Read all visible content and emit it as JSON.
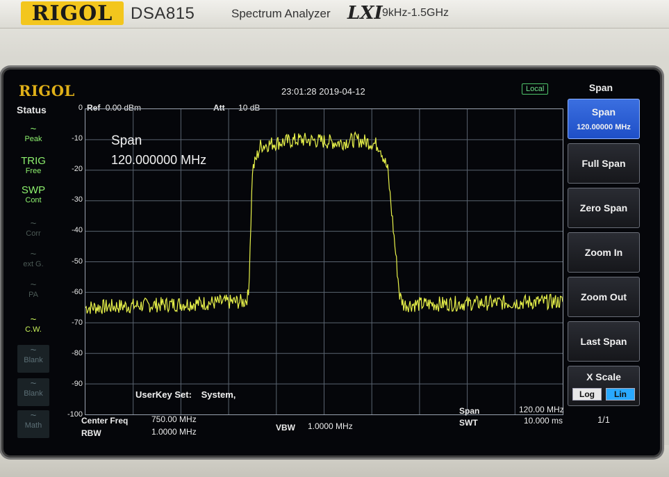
{
  "device": {
    "brand": "RIGOL",
    "model": "DSA815",
    "product": "Spectrum Analyzer",
    "lxi": "LXI",
    "range": "9kHz-1.5GHz"
  },
  "screen": {
    "logo": "RIGOL",
    "timestamp": "23:01:28 2019-04-12",
    "remote": "Local"
  },
  "status": {
    "title": "Status",
    "items": [
      {
        "symbol": "~",
        "label": "Peak",
        "state": "on"
      },
      {
        "symbol": "TRIG",
        "label": "Free",
        "state": "on"
      },
      {
        "symbol": "SWP",
        "label": "Cont",
        "state": "on"
      },
      {
        "symbol": "~",
        "label": "Corr",
        "state": "off"
      },
      {
        "symbol": "~",
        "label": "ext G.",
        "state": "off"
      },
      {
        "symbol": "~",
        "label": "PA",
        "state": "off"
      },
      {
        "symbol": "~",
        "label": "C.W.",
        "state": "lit"
      },
      {
        "symbol": "~",
        "label": "Blank",
        "state": "tile"
      },
      {
        "symbol": "~",
        "label": "Blank",
        "state": "tile"
      },
      {
        "symbol": "~",
        "label": "Math",
        "state": "tile"
      }
    ]
  },
  "header": {
    "ref_label": "Ref",
    "ref_value": "0.00 dBm",
    "att_label": "Att",
    "att_value": "10 dB"
  },
  "overlay": {
    "param": "Span",
    "value": "120.000000 MHz",
    "userkey_label": "UserKey Set:",
    "userkey_value": "System,"
  },
  "footer": {
    "center_label": "Center Freq",
    "center_value": "750.00 MHz",
    "rbw_label": "RBW",
    "rbw_value": "1.0000 MHz",
    "vbw_label": "VBW",
    "vbw_value": "1.0000 MHz",
    "span_label": "Span",
    "span_value": "120.00 MHz",
    "swt_label": "SWT",
    "swt_value": "10.000 ms"
  },
  "menu": {
    "title": "Span",
    "items": [
      {
        "label": "Span",
        "sub": "120.00000 MHz",
        "active": true
      },
      {
        "label": "Full Span"
      },
      {
        "label": "Zero Span"
      },
      {
        "label": "Zoom In"
      },
      {
        "label": "Zoom Out"
      },
      {
        "label": "Last Span"
      },
      {
        "label": "X Scale",
        "options": [
          "Log",
          "Lin"
        ],
        "selected": "Lin"
      }
    ],
    "page": "1/1"
  },
  "chart_data": {
    "type": "line",
    "ylabel": "",
    "y_unit": "dBm",
    "ylim": [
      -100,
      0
    ],
    "yticks": [
      "0",
      "-10",
      "-20",
      "-30",
      "-40",
      "-50",
      "-60",
      "-70",
      "-80",
      "-90",
      "-100"
    ],
    "x_divisions": 10,
    "y_divisions": 10,
    "grid": true,
    "trace_color": "#e8f24a",
    "xlim_mhz": [
      690,
      750
    ],
    "series": [
      {
        "x_mhz": [
          690,
          710,
          710.5,
          711,
          712,
          714,
          717,
          720,
          722,
          724,
          726,
          727,
          728,
          729.5,
          730,
          730.5,
          740,
          750
        ],
        "y_dbm": [
          -65,
          -63,
          -61,
          -20,
          -12,
          -11,
          -10,
          -10.5,
          -11,
          -10,
          -11,
          -12,
          -20,
          -61,
          -64,
          -64,
          -63.5,
          -63
        ]
      }
    ]
  }
}
